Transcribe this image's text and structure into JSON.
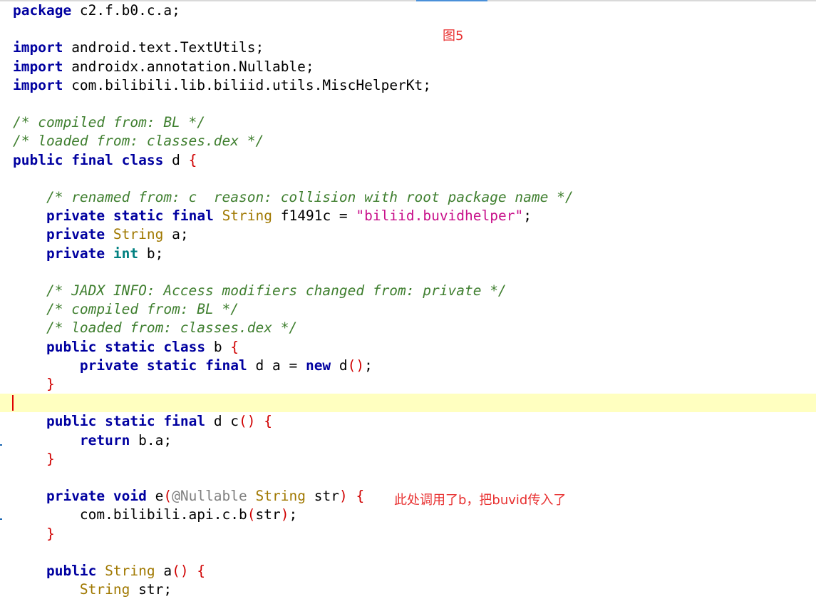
{
  "figure_label": "图5",
  "note_text": "此处调用了b，把buvid传入了",
  "colors": {
    "keyword": "#0000a0",
    "primitive": "#008080",
    "type": "#a07800",
    "string": "#c8108a",
    "comment": "#3f7f2f",
    "annotation": "#808080",
    "bracket": "#d00000",
    "note": "#e83030",
    "current_line": "#ffffc0"
  },
  "code_lines": [
    [
      [
        "kw",
        "package"
      ],
      [
        "id",
        " c2.f.b0.c.a;"
      ]
    ],
    [],
    [
      [
        "kw",
        "import"
      ],
      [
        "id",
        " android.text.TextUtils;"
      ]
    ],
    [
      [
        "kw",
        "import"
      ],
      [
        "id",
        " androidx.annotation.Nullable;"
      ]
    ],
    [
      [
        "kw",
        "import"
      ],
      [
        "id",
        " com.bilibili.lib.biliid.utils.MiscHelperKt;"
      ]
    ],
    [],
    [
      [
        "cmt",
        "/* compiled from: BL */"
      ]
    ],
    [
      [
        "cmt",
        "/* loaded from: classes.dex */"
      ]
    ],
    [
      [
        "kw",
        "public"
      ],
      [
        "id",
        " "
      ],
      [
        "kw",
        "final"
      ],
      [
        "id",
        " "
      ],
      [
        "kw",
        "class"
      ],
      [
        "id",
        " d "
      ],
      [
        "br",
        "{"
      ]
    ],
    [],
    [
      [
        "id",
        "    "
      ],
      [
        "cmt",
        "/* renamed from: c  reason: collision with root package name */"
      ]
    ],
    [
      [
        "id",
        "    "
      ],
      [
        "kw",
        "private"
      ],
      [
        "id",
        " "
      ],
      [
        "kw",
        "static"
      ],
      [
        "id",
        " "
      ],
      [
        "kw",
        "final"
      ],
      [
        "id",
        " "
      ],
      [
        "type",
        "String"
      ],
      [
        "id",
        " f1491c = "
      ],
      [
        "str",
        "\"biliid.buvidhelper\""
      ],
      [
        "id",
        ";"
      ]
    ],
    [
      [
        "id",
        "    "
      ],
      [
        "kw",
        "private"
      ],
      [
        "id",
        " "
      ],
      [
        "type",
        "String"
      ],
      [
        "id",
        " a;"
      ]
    ],
    [
      [
        "id",
        "    "
      ],
      [
        "kw",
        "private"
      ],
      [
        "id",
        " "
      ],
      [
        "kw2",
        "int"
      ],
      [
        "id",
        " b;"
      ]
    ],
    [],
    [
      [
        "id",
        "    "
      ],
      [
        "cmt",
        "/* JADX INFO: Access modifiers changed from: private */"
      ]
    ],
    [
      [
        "id",
        "    "
      ],
      [
        "cmt",
        "/* compiled from: BL */"
      ]
    ],
    [
      [
        "id",
        "    "
      ],
      [
        "cmt",
        "/* loaded from: classes.dex */"
      ]
    ],
    [
      [
        "id",
        "    "
      ],
      [
        "kw",
        "public"
      ],
      [
        "id",
        " "
      ],
      [
        "kw",
        "static"
      ],
      [
        "id",
        " "
      ],
      [
        "kw",
        "class"
      ],
      [
        "id",
        " b "
      ],
      [
        "br",
        "{"
      ]
    ],
    [
      [
        "id",
        "        "
      ],
      [
        "kw",
        "private"
      ],
      [
        "id",
        " "
      ],
      [
        "kw",
        "static"
      ],
      [
        "id",
        " "
      ],
      [
        "kw",
        "final"
      ],
      [
        "id",
        " d a = "
      ],
      [
        "kw",
        "new"
      ],
      [
        "id",
        " d"
      ],
      [
        "br",
        "()"
      ],
      [
        "id",
        ";"
      ]
    ],
    [
      [
        "id",
        "    "
      ],
      [
        "br",
        "}"
      ]
    ],
    [],
    [
      [
        "id",
        "    "
      ],
      [
        "kw",
        "public"
      ],
      [
        "id",
        " "
      ],
      [
        "kw",
        "static"
      ],
      [
        "id",
        " "
      ],
      [
        "kw",
        "final"
      ],
      [
        "id",
        " d c"
      ],
      [
        "br",
        "()"
      ],
      [
        "id",
        " "
      ],
      [
        "br",
        "{"
      ]
    ],
    [
      [
        "id",
        "        "
      ],
      [
        "kw",
        "return"
      ],
      [
        "id",
        " b.a;"
      ]
    ],
    [
      [
        "id",
        "    "
      ],
      [
        "br",
        "}"
      ]
    ],
    [],
    [
      [
        "id",
        "    "
      ],
      [
        "kw",
        "private"
      ],
      [
        "id",
        " "
      ],
      [
        "kw",
        "void"
      ],
      [
        "id",
        " e"
      ],
      [
        "br",
        "("
      ],
      [
        "ann",
        "@Nullable"
      ],
      [
        "id",
        " "
      ],
      [
        "type",
        "String"
      ],
      [
        "id",
        " str"
      ],
      [
        "br",
        ")"
      ],
      [
        "id",
        " "
      ],
      [
        "br",
        "{"
      ]
    ],
    [
      [
        "id",
        "        com.bilibili.api.c.b"
      ],
      [
        "br",
        "("
      ],
      [
        "id",
        "str"
      ],
      [
        "br",
        ")"
      ],
      [
        "id",
        ";"
      ]
    ],
    [
      [
        "id",
        "    "
      ],
      [
        "br",
        "}"
      ]
    ],
    [],
    [
      [
        "id",
        "    "
      ],
      [
        "kw",
        "public"
      ],
      [
        "id",
        " "
      ],
      [
        "type",
        "String"
      ],
      [
        "id",
        " a"
      ],
      [
        "br",
        "()"
      ],
      [
        "id",
        " "
      ],
      [
        "br",
        "{"
      ]
    ],
    [
      [
        "id",
        "        "
      ],
      [
        "type",
        "String"
      ],
      [
        "id",
        " str;"
      ]
    ]
  ]
}
